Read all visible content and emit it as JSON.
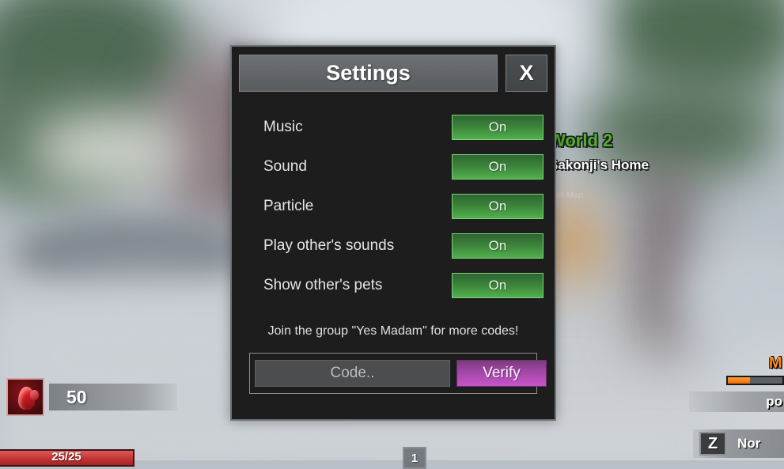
{
  "hud": {
    "currency": {
      "icon": "red-gem-icon",
      "amount": "50"
    },
    "health": {
      "text": "25/25"
    },
    "hotbar": {
      "slot_1": "1"
    },
    "right": {
      "mastery_label": "M",
      "mastery_progress_percent": 40,
      "points_label": "po",
      "keybind": "Z",
      "keybind_label": "Nor"
    }
  },
  "world": {
    "name": "World 2",
    "sub": "Sakonji's Home",
    "player": "art Man"
  },
  "panel": {
    "title": "Settings",
    "close_label": "X",
    "settings": [
      {
        "label": "Music",
        "value": "On"
      },
      {
        "label": "Sound",
        "value": "On"
      },
      {
        "label": "Particle",
        "value": "On"
      },
      {
        "label": "Play other's sounds",
        "value": "On"
      },
      {
        "label": "Show other's pets",
        "value": "On"
      }
    ],
    "group_note": "Join the group \"Yes Madam\" for more codes!",
    "code_placeholder": "Code..",
    "code_value": "",
    "verify_label": "Verify"
  },
  "colors": {
    "panel_bg": "#1d1d1d",
    "toggle_green": "#51b04d",
    "verify_magenta": "#c754c9",
    "world_green": "#54b02c",
    "mastery_orange": "#ff8c1a"
  }
}
